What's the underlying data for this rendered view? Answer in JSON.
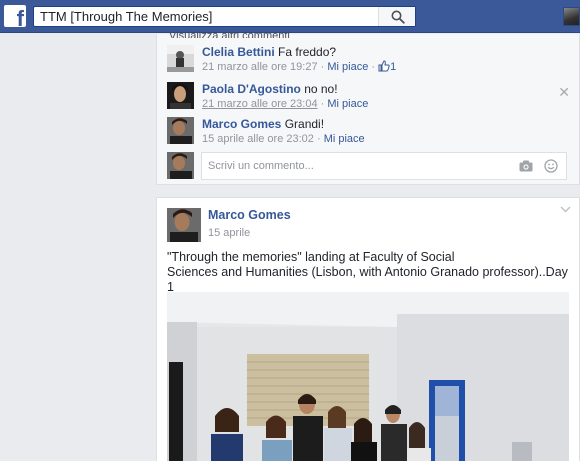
{
  "topbar": {
    "logo_glyph": "f",
    "search_value": "TTM [Through The Memories]",
    "search_icon": "search-icon"
  },
  "comments": {
    "cut_heading": "Visualizza altri commenti",
    "items": [
      {
        "author": "Clelia Bettini",
        "text": "Fa freddo?",
        "time": "21 marzo alle ore 19:27",
        "like_label": "Mi piace",
        "likes": "1"
      },
      {
        "author": "Paola D'Agostino",
        "text": "no no!",
        "time": "21 marzo alle ore 23:04",
        "like_label": "Mi piace"
      },
      {
        "author": "Marco Gomes",
        "text": "Grandi!",
        "time": "15 aprile alle ore 23:02",
        "like_label": "Mi piace"
      }
    ],
    "separator": " · ",
    "reply_placeholder": "Scrivi un commento..."
  },
  "post": {
    "author": "Marco Gomes",
    "date": "15 aprile",
    "text_line1": "\"Through the memories\" landing at Faculty of Social",
    "text_line2": "Sciences and Humanities (Lisbon, with Antonio Granado professor)..Day 1"
  },
  "colors": {
    "brand": "#3b5998",
    "link": "#365899",
    "meta": "#90949c",
    "background": "#e9ebee"
  }
}
